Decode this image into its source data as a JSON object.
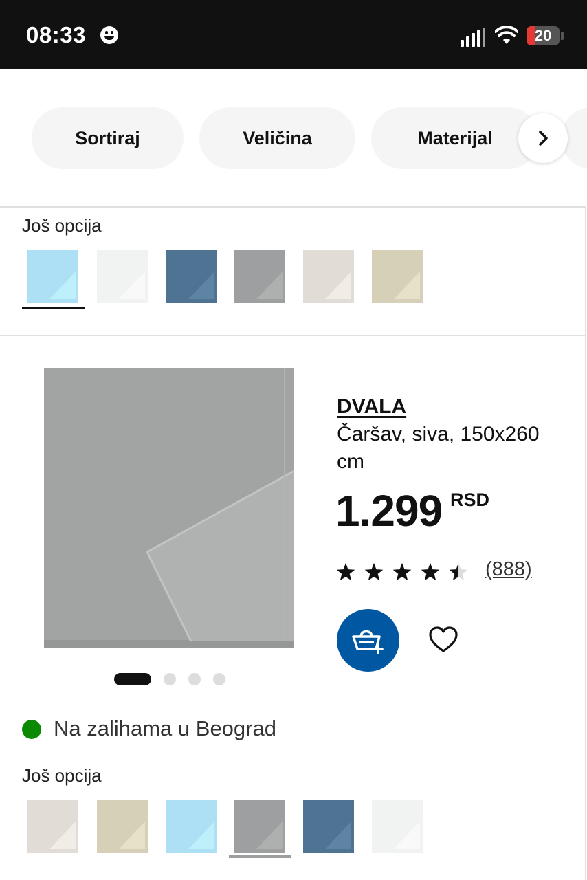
{
  "status_bar": {
    "time": "08:33",
    "battery": "20"
  },
  "filters": {
    "chips": [
      "Sortiraj",
      "Veličina",
      "Materijal"
    ]
  },
  "options_top": {
    "label": "Još opcija",
    "swatches": [
      "#aee0f5",
      "#f1f2f2",
      "#4e7393",
      "#9d9fa0",
      "#e1dcd6",
      "#d6d0b8"
    ],
    "selected_index": 0
  },
  "product": {
    "name": "DVALA",
    "description": "Čaršav, siva, 150x260 cm",
    "price": "1.299",
    "currency": "RSD",
    "rating": 4.5,
    "reviews": "(888)",
    "image_color": "#a2a3a3",
    "carousel_count": 4,
    "carousel_active": 0
  },
  "stock": {
    "text": "Na zalihama u Beograd",
    "color": "#0a8a00"
  },
  "options_bottom": {
    "label": "Još opcija",
    "swatches": [
      "#e1dcd6",
      "#d6d0b8",
      "#aee0f5",
      "#9d9fa0",
      "#4e7393",
      "#f1f2f2"
    ],
    "selected_index": 3
  },
  "colors": {
    "accent": "#0058a3"
  }
}
